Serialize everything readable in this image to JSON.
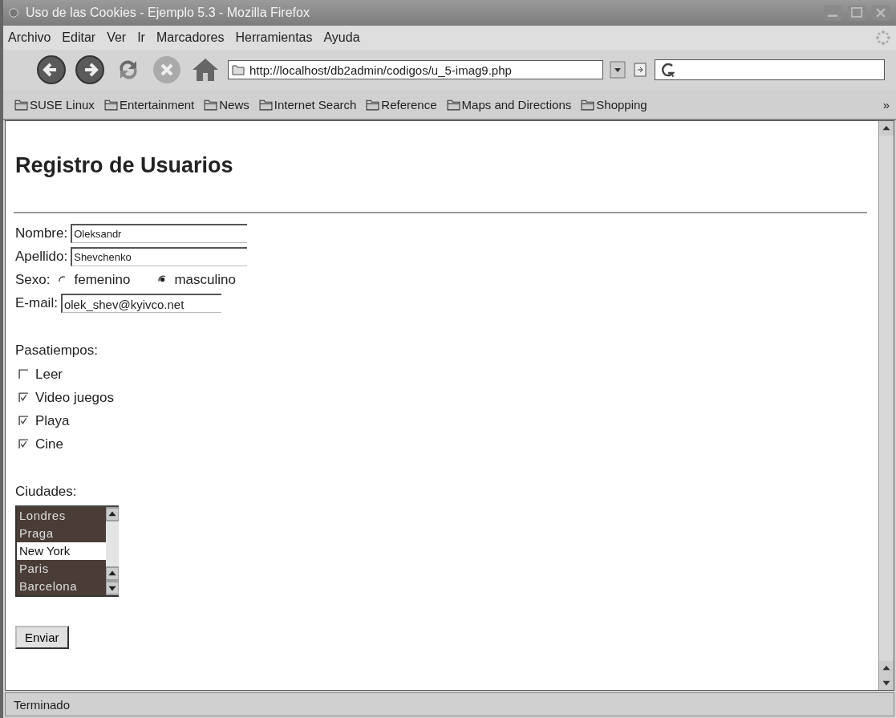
{
  "window": {
    "title": "Uso de las Cookies - Ejemplo 5.3 - Mozilla Firefox"
  },
  "menu": [
    "Archivo",
    "Editar",
    "Ver",
    "Ir",
    "Marcadores",
    "Herramientas",
    "Ayuda"
  ],
  "address": {
    "value": "http://localhost/db2admin/codigos/u_5-imag9.php"
  },
  "bookmarks": {
    "items": [
      "SUSE Linux",
      "Entertainment",
      "News",
      "Internet Search",
      "Reference",
      "Maps and Directions",
      "Shopping"
    ],
    "overflow": "»"
  },
  "page": {
    "heading": "Registro de Usuarios",
    "fields": [
      {
        "label": "Nombre:",
        "value": "Oleksandr"
      },
      {
        "label": "Apellido:",
        "value": "Shevchenko"
      }
    ],
    "sexo": {
      "label": "Sexo:",
      "options": [
        {
          "label": "femenino",
          "selected": false
        },
        {
          "label": "masculino",
          "selected": true
        }
      ]
    },
    "email": {
      "label": "E-mail:",
      "value": "olek_shev@kyivco.net"
    },
    "hobbies": {
      "label": "Pasatiempos:",
      "items": [
        {
          "label": "Leer",
          "checked": false
        },
        {
          "label": "Video juegos",
          "checked": true
        },
        {
          "label": "Playa",
          "checked": true
        },
        {
          "label": "Cine",
          "checked": true
        }
      ]
    },
    "cities": {
      "label": "Ciudades:",
      "items": [
        {
          "label": "Londres",
          "selected": true
        },
        {
          "label": "Praga",
          "selected": true
        },
        {
          "label": "New York",
          "selected": false
        },
        {
          "label": "Paris",
          "selected": true
        },
        {
          "label": "Barcelona",
          "selected": true
        }
      ]
    },
    "submit": "Enviar"
  },
  "status_bar": "Terminado"
}
